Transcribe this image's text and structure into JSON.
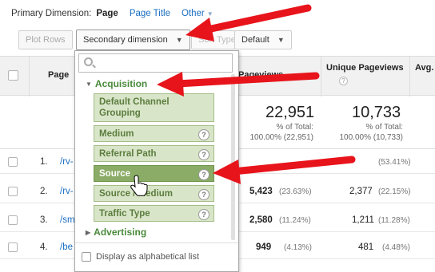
{
  "primary_dimension": {
    "label": "Primary Dimension:",
    "current": "Page",
    "options": [
      "Page Title",
      "Other"
    ]
  },
  "toolbar": {
    "plot_rows": "Plot Rows",
    "secondary_dimension": "Secondary dimension",
    "sort_type": "Sort Type:",
    "default_select": "Default"
  },
  "table": {
    "headers": {
      "page": "Page",
      "pageviews": "Pageviews",
      "unique_pageviews": "Unique Pageviews",
      "avg": "Avg."
    },
    "totals": {
      "pageviews": "22,951",
      "pageviews_pct_label": "% of Total:",
      "pageviews_pct": "100.00% (22,951)",
      "unique": "10,733",
      "unique_pct_label": "% of Total:",
      "unique_pct": "100.00% (10,733)"
    },
    "rows": [
      {
        "num": "1.",
        "page": "/rv-",
        "pageviews": "",
        "pageviews_pct": "",
        "unique": "",
        "unique_pct": "(53.41%)"
      },
      {
        "num": "2.",
        "page": "/rv-",
        "pageviews": "5,423",
        "pageviews_pct": "(23.63%)",
        "unique": "2,377",
        "unique_pct": "(22.15%)"
      },
      {
        "num": "3.",
        "page": "/sm",
        "pageviews": "2,580",
        "pageviews_pct": "(11.24%)",
        "unique": "1,211",
        "unique_pct": "(11.28%)"
      },
      {
        "num": "4.",
        "page": "/be",
        "pageviews": "949",
        "pageviews_pct": "(4.13%)",
        "unique": "481",
        "unique_pct": "(4.48%)"
      }
    ]
  },
  "dropdown": {
    "search_placeholder": "",
    "groups": [
      {
        "label": "Acquisition",
        "expanded": true
      },
      {
        "label": "Advertising",
        "expanded": false
      }
    ],
    "items": [
      {
        "label": "Default Channel Grouping",
        "help": false,
        "selected": false
      },
      {
        "label": "Medium",
        "help": true,
        "selected": false
      },
      {
        "label": "Referral Path",
        "help": true,
        "selected": false
      },
      {
        "label": "Source",
        "help": true,
        "selected": true
      },
      {
        "label": "Source / Medium",
        "help": true,
        "selected": false
      },
      {
        "label": "Traffic Type",
        "help": true,
        "selected": false
      }
    ],
    "alphabetical_label": "Display as alphabetical list"
  },
  "colors": {
    "accent_link": "#1a6ec2",
    "group_green": "#4a8a3b",
    "item_bg": "#d9e5c8",
    "item_selected_bg": "#8aac66",
    "annotation_arrow": "#e8141b"
  },
  "icons": {
    "search": "search-icon",
    "help": "help-icon",
    "caret": "chevron-down-icon",
    "cursor": "hand-cursor-icon"
  }
}
